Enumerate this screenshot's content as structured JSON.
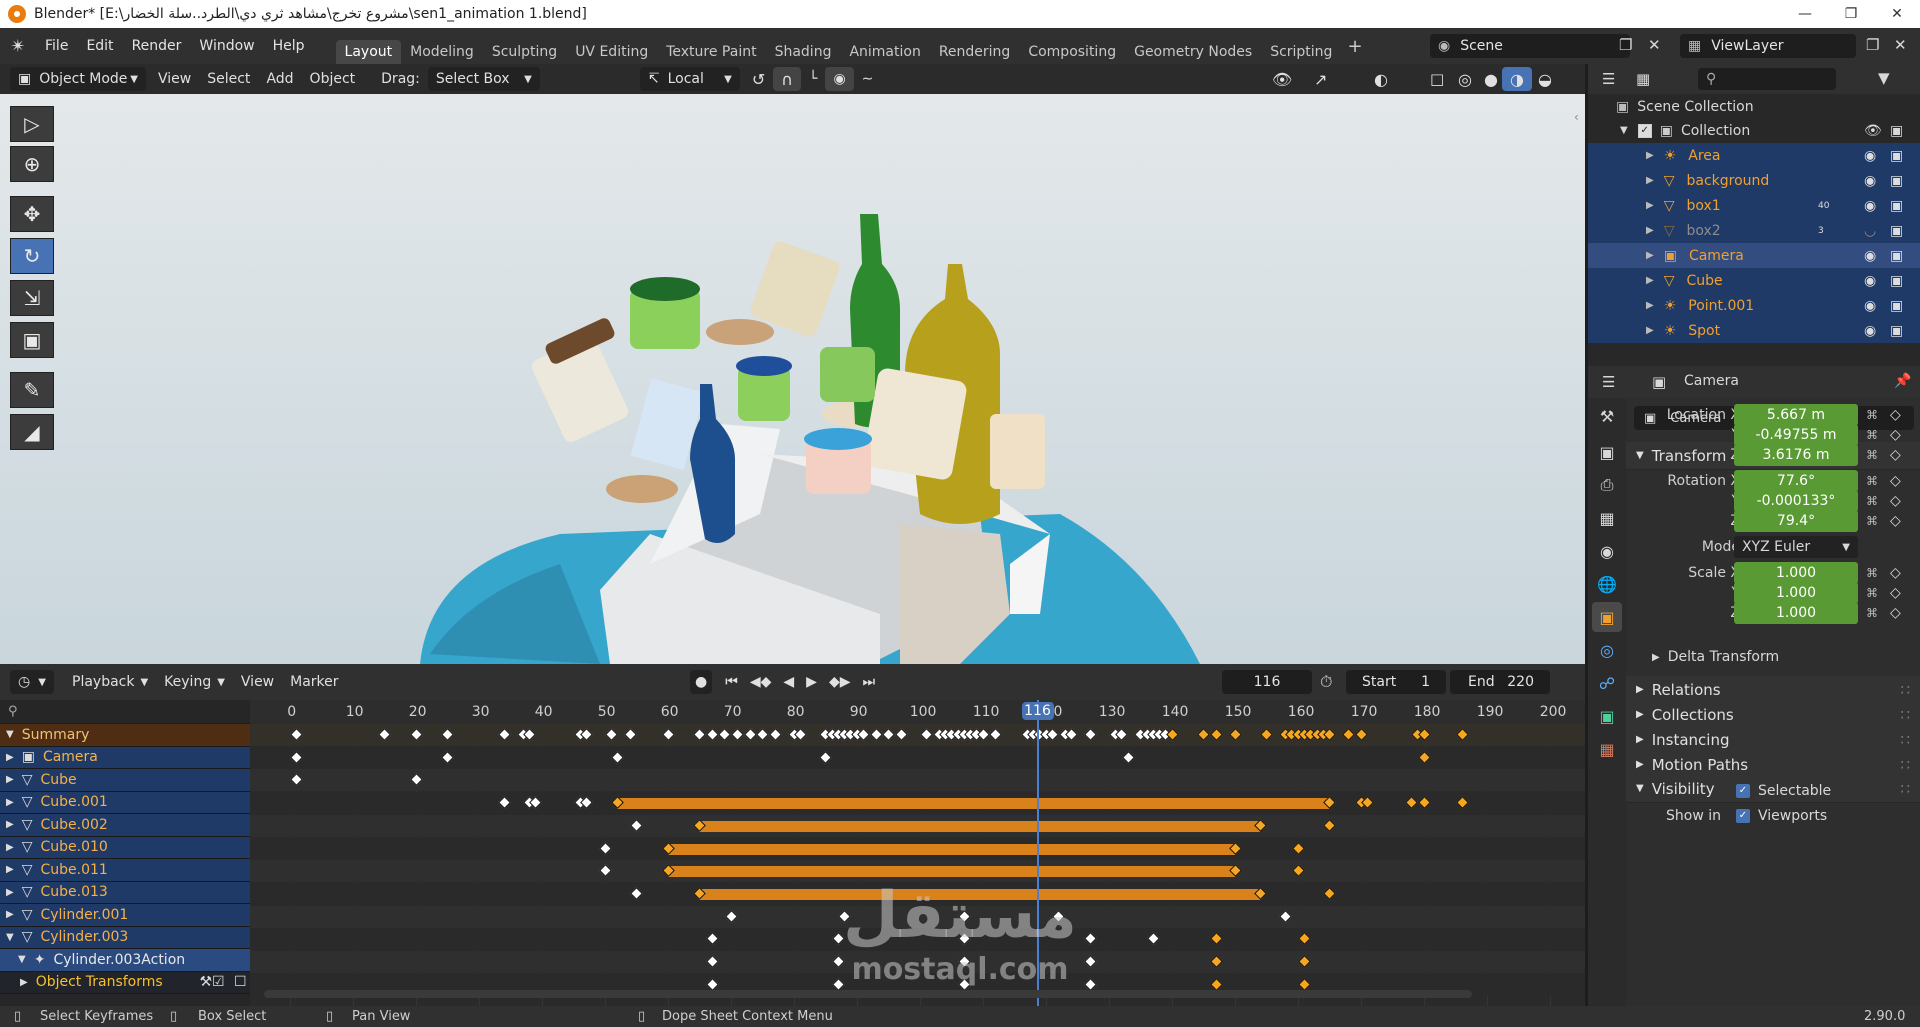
{
  "titlebar": {
    "title": "Blender* [E:\\مشروع تخرج\\مشاهد ثري دي\\الطرد..سلة الخضار\\sen1_animation 1.blend]"
  },
  "menubar": {
    "menus": [
      "File",
      "Edit",
      "Render",
      "Window",
      "Help"
    ],
    "workspaces": [
      "Layout",
      "Modeling",
      "Sculpting",
      "UV Editing",
      "Texture Paint",
      "Shading",
      "Animation",
      "Rendering",
      "Compositing",
      "Geometry Nodes",
      "Scripting"
    ],
    "active_workspace": "Layout",
    "add_tab": "+",
    "scene": "Scene",
    "view_layer": "ViewLayer"
  },
  "viewport_header": {
    "mode": "Object Mode",
    "menus": [
      "View",
      "Select",
      "Add",
      "Object"
    ],
    "drag_label": "Drag:",
    "drag_value": "Select Box",
    "orientation": "Local"
  },
  "dopesheet_header": {
    "menus": [
      "Playback",
      "Keying",
      "View",
      "Marker"
    ],
    "current_frame": "116",
    "start_label": "Start",
    "start_value": "1",
    "end_label": "End",
    "end_value": "220"
  },
  "timeline": {
    "ticks": [
      0,
      10,
      20,
      30,
      40,
      50,
      60,
      70,
      80,
      90,
      100,
      110,
      116,
      120,
      130,
      140,
      150,
      160,
      170,
      180,
      190,
      200
    ],
    "current_frame": 116,
    "rows": [
      {
        "keys": [
          1,
          15,
          20,
          25,
          34,
          37,
          38,
          46,
          47,
          51,
          54,
          60,
          65,
          67,
          69,
          71,
          73,
          75,
          77,
          80,
          81,
          85,
          86,
          87,
          88,
          89,
          90,
          91,
          93,
          95,
          97,
          101,
          103,
          104,
          105,
          106,
          107,
          108,
          109,
          110,
          112,
          117,
          118,
          119,
          120,
          121,
          123,
          124,
          127,
          131,
          132,
          135,
          136,
          137,
          138,
          139
        ],
        "sel_keys": [
          140,
          145,
          147,
          150,
          155,
          158,
          159,
          160,
          161,
          162,
          163,
          164,
          165,
          168,
          170,
          179,
          180,
          186
        ]
      },
      {
        "keys": [
          1,
          25,
          52,
          85,
          133
        ],
        "sel_keys": [
          180
        ]
      },
      {
        "keys": [
          1,
          20
        ],
        "sel_keys": []
      },
      {
        "keys": [
          34,
          38,
          39,
          46,
          47
        ],
        "sel_keys": [
          52,
          165,
          170,
          171,
          178,
          180,
          186
        ],
        "bar": [
          52,
          165
        ]
      },
      {
        "keys": [
          55
        ],
        "sel_keys": [
          65,
          154,
          165
        ],
        "bar": [
          65,
          154
        ]
      },
      {
        "keys": [
          50
        ],
        "sel_keys": [
          60,
          150,
          160
        ],
        "bar": [
          60,
          150
        ]
      },
      {
        "keys": [
          50
        ],
        "sel_keys": [
          60,
          150,
          160
        ],
        "bar": [
          60,
          150
        ]
      },
      {
        "keys": [
          55
        ],
        "sel_keys": [
          65,
          154,
          165
        ],
        "bar": [
          65,
          154
        ]
      },
      {
        "keys": [
          70,
          88,
          107,
          122,
          158
        ],
        "sel_keys": []
      },
      {
        "keys": [
          67,
          87,
          107,
          127,
          137
        ],
        "sel_keys": [
          147,
          161
        ]
      },
      {
        "keys": [
          67,
          87,
          107,
          127
        ],
        "sel_keys": [
          147,
          161
        ]
      },
      {
        "keys": [
          67,
          87,
          107,
          127
        ],
        "sel_keys": [
          147,
          161
        ]
      }
    ]
  },
  "channels": [
    {
      "name": "Summary",
      "type": "summary"
    },
    {
      "name": "Camera",
      "type": "object"
    },
    {
      "name": "Cube",
      "type": "object"
    },
    {
      "name": "Cube.001",
      "type": "object"
    },
    {
      "name": "Cube.002",
      "type": "object"
    },
    {
      "name": "Cube.010",
      "type": "object"
    },
    {
      "name": "Cube.011",
      "type": "object"
    },
    {
      "name": "Cube.013",
      "type": "object"
    },
    {
      "name": "Cylinder.001",
      "type": "object"
    },
    {
      "name": "Cylinder.003",
      "type": "object"
    },
    {
      "name": "Cylinder.003Action",
      "type": "action"
    },
    {
      "name": "Object Transforms",
      "type": "group"
    }
  ],
  "outliner": {
    "root": "Scene Collection",
    "collection": "Collection",
    "items": [
      {
        "name": "Area",
        "kind": "light"
      },
      {
        "name": "background",
        "kind": "mesh"
      },
      {
        "name": "box1",
        "kind": "mesh",
        "badge": "40"
      },
      {
        "name": "box2",
        "kind": "mesh",
        "badge": "3"
      },
      {
        "name": "Camera",
        "kind": "camera"
      },
      {
        "name": "Cube",
        "kind": "mesh"
      },
      {
        "name": "Point.001",
        "kind": "light"
      },
      {
        "name": "Spot",
        "kind": "light"
      }
    ]
  },
  "properties": {
    "header_object": "Camera",
    "object_name": "Camera",
    "transform_label": "Transform",
    "location_label": "Location X",
    "location": [
      "5.667 m",
      "-0.49755 m",
      "3.6176 m"
    ],
    "rotation_label": "Rotation X",
    "rotation": [
      "77.6°",
      "-0.000133°",
      "79.4°"
    ],
    "mode_label": "Mode",
    "mode_value": "XYZ Euler",
    "scale_label": "Scale X",
    "scale": [
      "1.000",
      "1.000",
      "1.000"
    ],
    "axis_y": "Y",
    "axis_z": "Z",
    "sections": [
      "Delta Transform",
      "Relations",
      "Collections",
      "Instancing",
      "Motion Paths",
      "Visibility"
    ],
    "selectable": "Selectable",
    "show_in": "Show in",
    "viewports": "Viewports"
  },
  "statusbar": {
    "select": "Select Keyframes",
    "box": "Box Select",
    "pan": "Pan View",
    "context": "Dope Sheet Context Menu",
    "version": "2.90.0"
  },
  "watermark": {
    "arabic": "مستقل",
    "latin": "mostaql.com"
  },
  "colors": {
    "selected_key": "#f5a623",
    "keyframe_bar": "#d9811b",
    "value_field": "#5a9a34",
    "selection": "#334d80",
    "accent": "#4772b3"
  }
}
